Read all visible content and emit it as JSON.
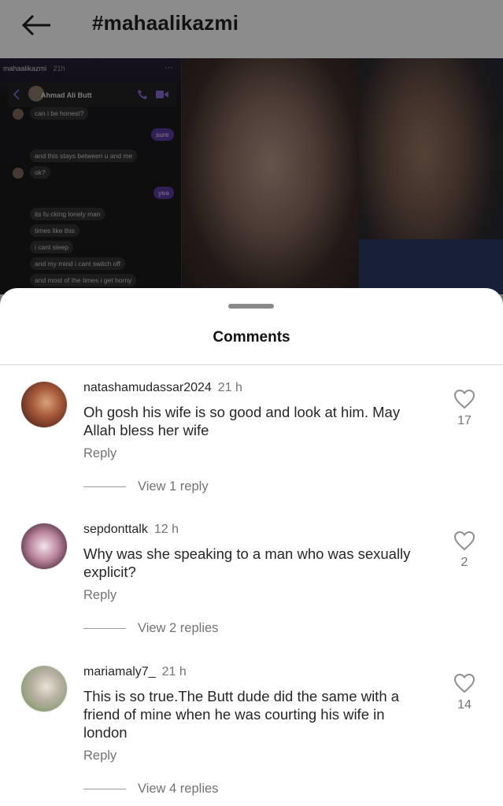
{
  "header": {
    "title": "#mahaalikazmi"
  },
  "post_image": {
    "chat": {
      "username": "mahaalikazmi",
      "time": "21h",
      "more": "···",
      "contact": "Ahmad Ali Butt",
      "messages": [
        "can i be honest?",
        "sure",
        "and this stays between u and me",
        "ok?",
        "yea",
        "its fu cking lonely man",
        "times like this",
        "i cant sleep",
        "and my mind i cant switch off",
        "and most of the times i get horny"
      ]
    }
  },
  "sheet": {
    "title": "Comments"
  },
  "comments": [
    {
      "username": "natashamudassar2024",
      "time": "21 h",
      "text": "Oh gosh his wife is so good and look at him. May Allah bless her wife",
      "reply": "Reply",
      "view_replies": "View 1 reply",
      "likes": "17"
    },
    {
      "username": "sepdonttalk",
      "time": "12 h",
      "text": "Why was she speaking to a man who was sexually explicit?",
      "reply": "Reply",
      "view_replies": "View 2 replies",
      "likes": "2"
    },
    {
      "username": "mariamaly7_",
      "time": "21 h",
      "text": "This is so true.The Butt dude did the same with a friend of mine when he was courting his wife in london",
      "reply": "Reply",
      "view_replies": "View 4 replies",
      "likes": "14"
    }
  ]
}
